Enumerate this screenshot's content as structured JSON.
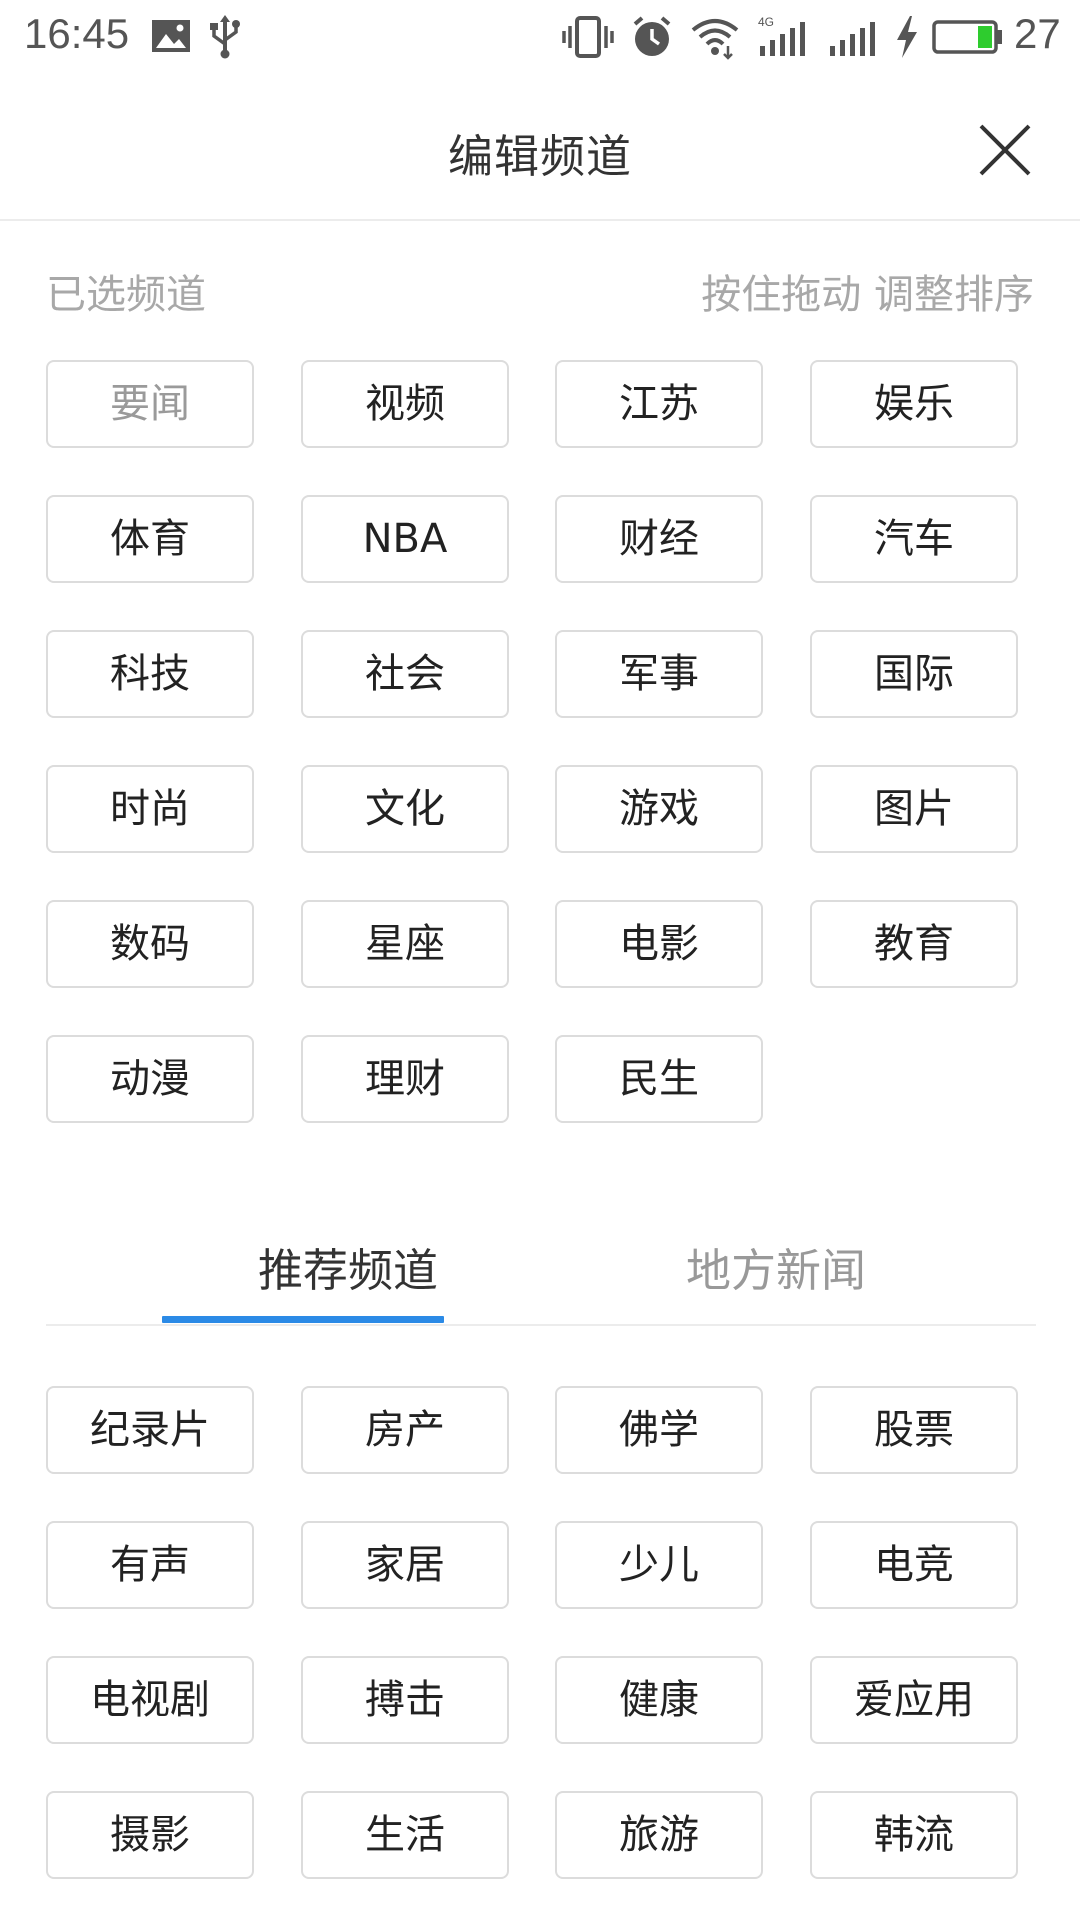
{
  "status_bar": {
    "time": "16:45",
    "battery": "27",
    "icons": [
      "image-icon",
      "usb-icon",
      "vibrate-icon",
      "alarm-icon",
      "wifi-icon",
      "signal-4g-icon",
      "signal-icon",
      "charging-icon",
      "battery-icon"
    ],
    "network_label": "4G",
    "battery_color": "#2ecc2e"
  },
  "header": {
    "title": "编辑频道",
    "close_icon": "close-icon"
  },
  "selected_section": {
    "title": "已选频道",
    "hint": "按住拖动 调整排序",
    "channels": [
      "要闻",
      "视频",
      "江苏",
      "娱乐",
      "体育",
      "NBA",
      "财经",
      "汽车",
      "科技",
      "社会",
      "军事",
      "国际",
      "时尚",
      "文化",
      "游戏",
      "图片",
      "数码",
      "星座",
      "电影",
      "教育",
      "动漫",
      "理财",
      "民生"
    ]
  },
  "tabs": {
    "items": [
      "推荐频道",
      "地方新闻"
    ],
    "active": "推荐频道",
    "accent_color": "#2b8ae6"
  },
  "recommended_section": {
    "channels": [
      "纪录片",
      "房产",
      "佛学",
      "股票",
      "有声",
      "家居",
      "少儿",
      "电竞",
      "电视剧",
      "搏击",
      "健康",
      "爱应用",
      "摄影",
      "生活",
      "旅游",
      "韩流"
    ]
  }
}
